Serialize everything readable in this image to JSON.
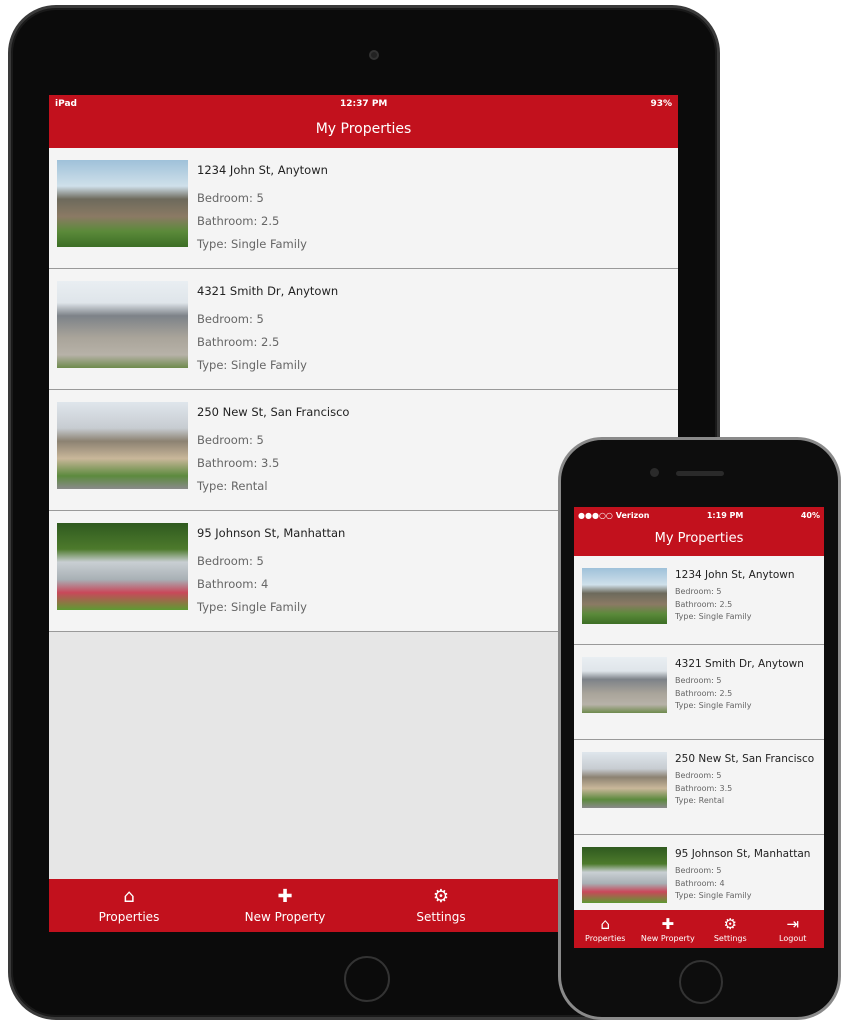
{
  "accent_color": "#c2111d",
  "properties": [
    {
      "address": "1234 John St, Anytown",
      "bedroom": "Bedroom: 5",
      "bathroom": "Bathroom: 2.5",
      "type": "Type: Single Family"
    },
    {
      "address": "4321 Smith Dr, Anytown",
      "bedroom": "Bedroom: 5",
      "bathroom": "Bathroom: 2.5",
      "type": "Type: Single Family"
    },
    {
      "address": "250 New St, San Francisco",
      "bedroom": "Bedroom: 5",
      "bathroom": "Bathroom: 3.5",
      "type": "Type: Rental"
    },
    {
      "address": "95 Johnson St, Manhattan",
      "bedroom": "Bedroom: 5",
      "bathroom": "Bathroom: 4",
      "type": "Type: Single Family"
    }
  ],
  "ipad": {
    "status": {
      "device": "iPad",
      "time": "12:37 PM",
      "battery": "93%"
    },
    "title": "My Properties",
    "tabs": [
      {
        "icon": "home-icon",
        "glyph": "⌂",
        "label": "Properties"
      },
      {
        "icon": "plus-icon",
        "glyph": "✚",
        "label": "New Property"
      },
      {
        "icon": "gear-icon",
        "glyph": "⚙",
        "label": "Settings"
      }
    ]
  },
  "iphone": {
    "status": {
      "carrier": "●●●○○ Verizon",
      "time": "1:19 PM",
      "battery": "40%"
    },
    "title": "My Properties",
    "tabs": [
      {
        "icon": "home-icon",
        "glyph": "⌂",
        "label": "Properties"
      },
      {
        "icon": "plus-icon",
        "glyph": "✚",
        "label": "New Property"
      },
      {
        "icon": "gear-icon",
        "glyph": "⚙",
        "label": "Settings"
      },
      {
        "icon": "logout-icon",
        "glyph": "⇥",
        "label": "Logout"
      }
    ]
  }
}
